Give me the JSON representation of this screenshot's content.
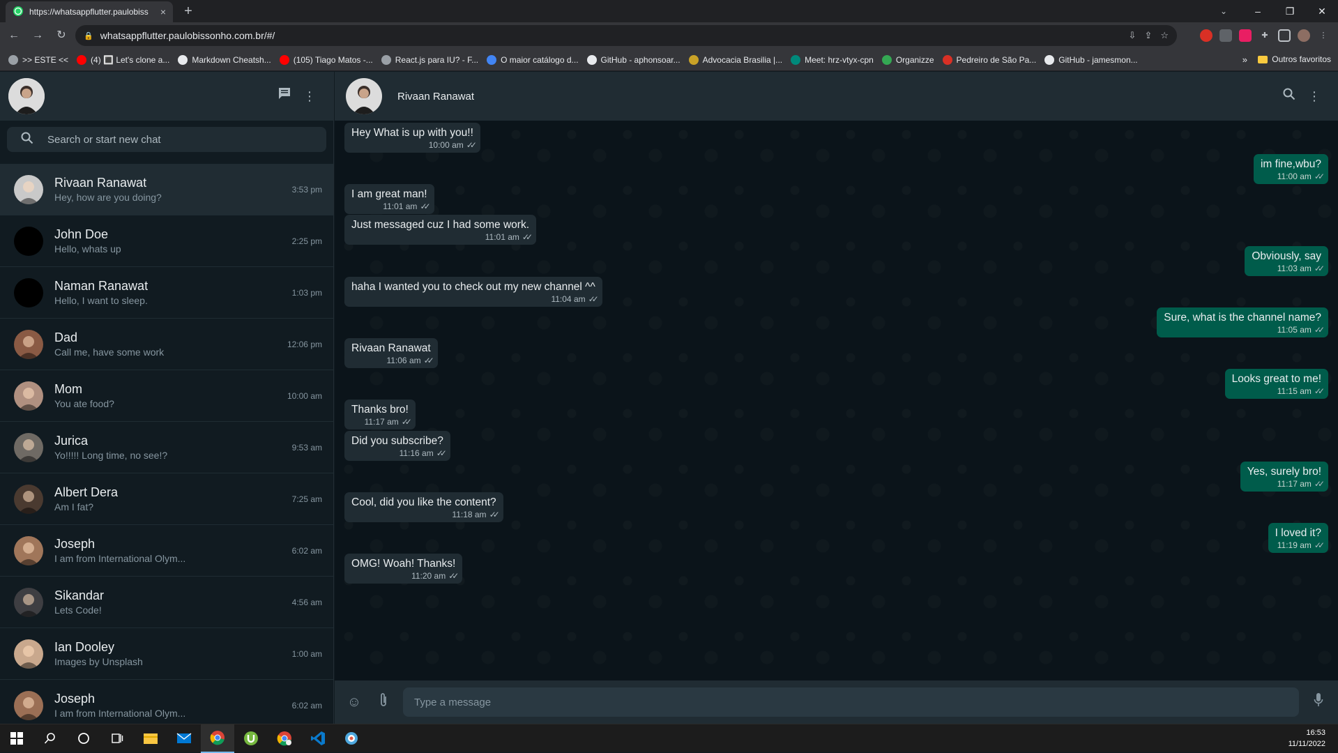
{
  "browser": {
    "tab_title": "https://whatsappflutter.paulobiss",
    "tab_close": "×",
    "new_tab": "+",
    "url": "whatsappflutter.paulobissonho.com.br/#/",
    "window_controls": [
      "–",
      "❐",
      "✕"
    ]
  },
  "bookmarks": [
    {
      "label": ">> ESTE <<",
      "color": "#9aa0a6"
    },
    {
      "label": "(4) 🔳 Let's clone a...",
      "color": "#ff0000"
    },
    {
      "label": "Markdown Cheatsh...",
      "color": "#e8eaed"
    },
    {
      "label": "(105) Tiago Matos -...",
      "color": "#ff0000"
    },
    {
      "label": "React.js para IU? - F...",
      "color": "#9aa0a6"
    },
    {
      "label": "O maior catálogo d...",
      "color": "#4285f4"
    },
    {
      "label": "GitHub - aphonsoar...",
      "color": "#e8eaed"
    },
    {
      "label": "Advocacia Brasilia |...",
      "color": "#c9a227"
    },
    {
      "label": "Meet: hrz-vtyx-cpn",
      "color": "#00897b"
    },
    {
      "label": "Organizze",
      "color": "#34a853"
    },
    {
      "label": "Pedreiro de São Pa...",
      "color": "#d93025"
    },
    {
      "label": "GitHub - jamesmon...",
      "color": "#e8eaed"
    }
  ],
  "bookmarks_more": "»",
  "bookmarks_other": "Outros favoritos",
  "sidebar": {
    "search_placeholder": "Search or start new chat",
    "chats": [
      {
        "name": "Rivaan Ranawat",
        "last": "Hey, how are you doing?",
        "time": "3:53 pm",
        "avatar": "#c9c9c9",
        "active": true
      },
      {
        "name": "John Doe",
        "last": "Hello, whats up",
        "time": "2:25 pm",
        "avatar": "#000000"
      },
      {
        "name": "Naman Ranawat",
        "last": "Hello, I want to sleep.",
        "time": "1:03 pm",
        "avatar": "#000000"
      },
      {
        "name": "Dad",
        "last": "Call me, have some work",
        "time": "12:06 pm",
        "avatar": "#8a5a44"
      },
      {
        "name": "Mom",
        "last": "You ate food?",
        "time": "10:00 am",
        "avatar": "#b09080"
      },
      {
        "name": "Jurica",
        "last": "Yo!!!!! Long time, no see!?",
        "time": "9:53 am",
        "avatar": "#6f6a64"
      },
      {
        "name": "Albert Dera",
        "last": "Am I fat?",
        "time": "7:25 am",
        "avatar": "#4a3a30"
      },
      {
        "name": "Joseph",
        "last": "I am from International Olym...",
        "time": "6:02 am",
        "avatar": "#a0765a"
      },
      {
        "name": "Sikandar",
        "last": "Lets Code!",
        "time": "4:56 am",
        "avatar": "#3e3e42"
      },
      {
        "name": "Ian Dooley",
        "last": "Images by Unsplash",
        "time": "1:00 am",
        "avatar": "#c9a88d"
      },
      {
        "name": "Joseph",
        "last": "I am from International Olym...",
        "time": "6:02 am",
        "avatar": "#9b6f55"
      }
    ]
  },
  "conversation": {
    "contact_name": "Rivaan Ranawat",
    "messages": [
      {
        "dir": "in",
        "text": "Hey What is up with you!!",
        "time": "10:00 am"
      },
      {
        "dir": "out",
        "text": "im fine,wbu?",
        "time": "11:00 am"
      },
      {
        "dir": "in",
        "text": "I am great man!",
        "time": "11:01 am"
      },
      {
        "dir": "in",
        "text": "Just messaged cuz I had some work.",
        "time": "11:01 am"
      },
      {
        "dir": "out",
        "text": "Obviously, say",
        "time": "11:03 am"
      },
      {
        "dir": "in",
        "text": "haha I wanted you to check out my new channel ^^",
        "time": "11:04 am"
      },
      {
        "dir": "out",
        "text": "Sure, what is the channel name?",
        "time": "11:05 am"
      },
      {
        "dir": "in",
        "text": "Rivaan Ranawat",
        "time": "11:06 am"
      },
      {
        "dir": "out",
        "text": "Looks great to me!",
        "time": "11:15 am"
      },
      {
        "dir": "in",
        "text": "Thanks bro!",
        "time": "11:17 am"
      },
      {
        "dir": "in",
        "text": "Did you subscribe?",
        "time": "11:16 am"
      },
      {
        "dir": "out",
        "text": "Yes, surely bro!",
        "time": "11:17 am"
      },
      {
        "dir": "in",
        "text": "Cool, did you like the content?",
        "time": "11:18 am"
      },
      {
        "dir": "out",
        "text": "I loved it?",
        "time": "11:19 am"
      },
      {
        "dir": "in",
        "text": "OMG! Woah! Thanks!",
        "time": "11:20 am"
      }
    ],
    "composer_placeholder": "Type a message"
  },
  "taskbar": {
    "time": "16:53",
    "date": "11/11/2022"
  },
  "colors": {
    "panel": "#202c33",
    "background": "#0b141a",
    "incoming_bubble": "#202c33",
    "outgoing_bubble": "#005c4b"
  }
}
